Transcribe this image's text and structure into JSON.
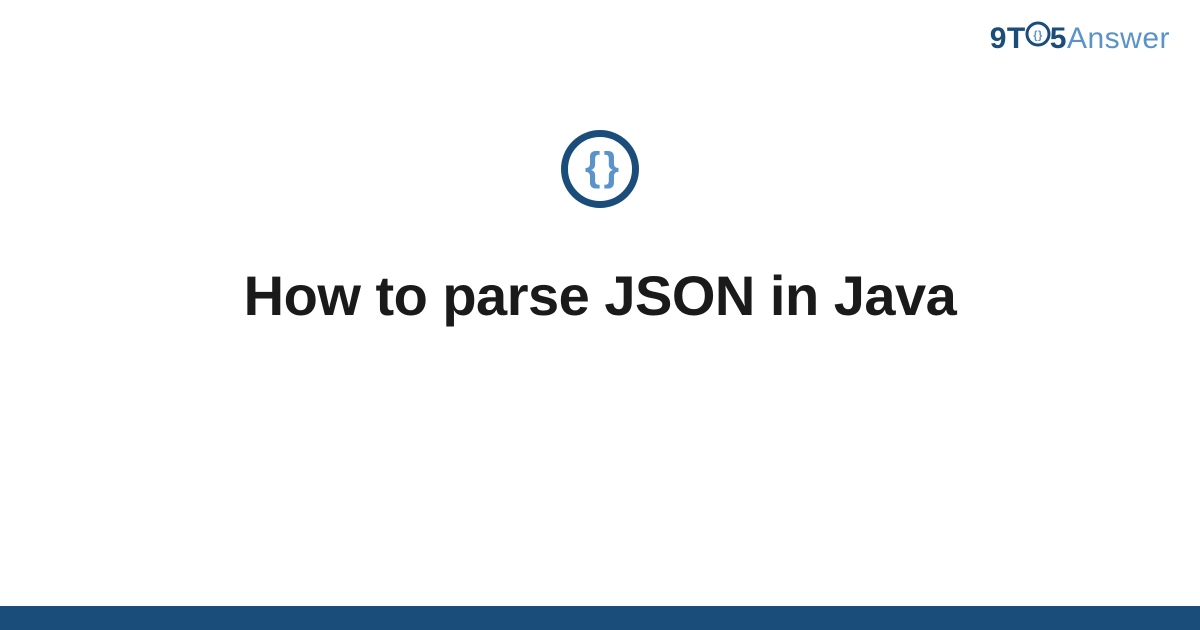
{
  "logo": {
    "part1": "9T",
    "part2": "5",
    "part3": "Answer"
  },
  "main": {
    "title": "How to parse JSON in Java",
    "icon_content": "{ }"
  },
  "colors": {
    "dark_blue": "#1a4d7a",
    "light_blue": "#5a93c8"
  }
}
